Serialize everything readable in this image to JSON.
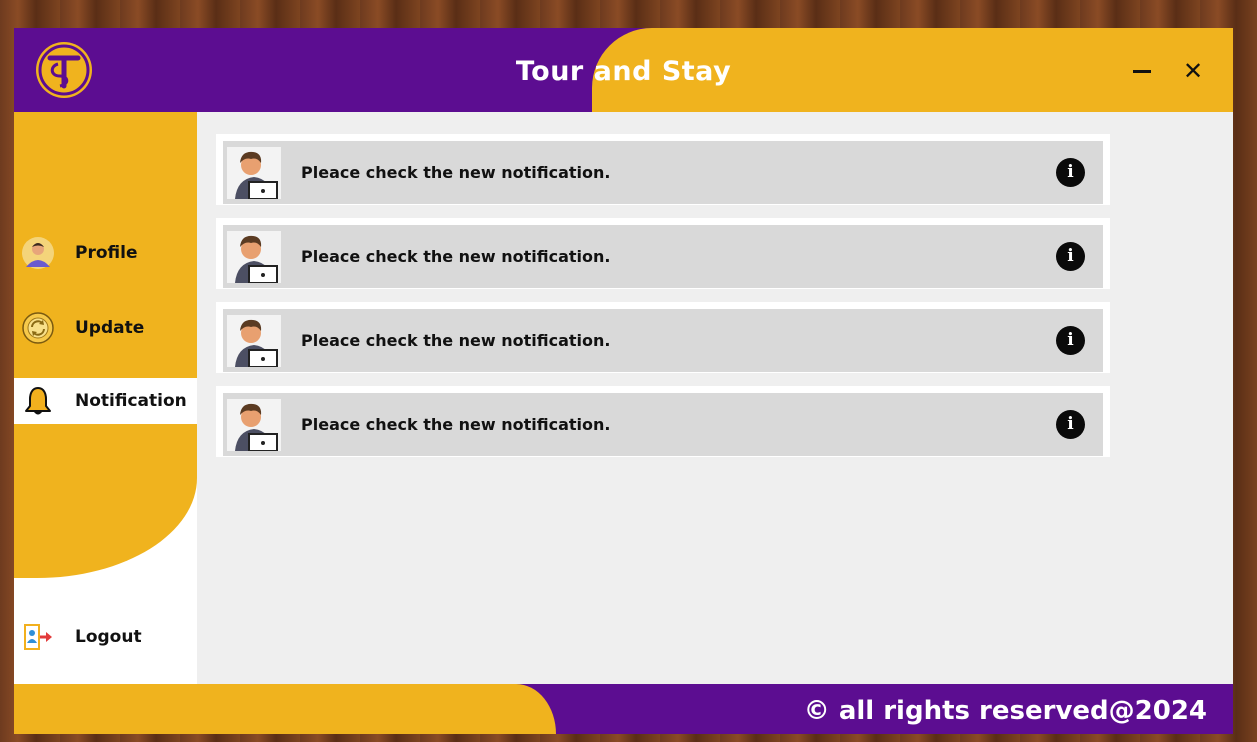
{
  "app": {
    "title_part1": "Tour an",
    "title_part2": "d Stay",
    "minimize_label": "–",
    "close_label": "✕"
  },
  "sidebar": {
    "items": [
      {
        "label": "Profile",
        "icon": "profile-avatar-icon"
      },
      {
        "label": "Update",
        "icon": "refresh-icon"
      },
      {
        "label": "Notification",
        "icon": "bell-icon",
        "active": true
      },
      {
        "label": "Logout",
        "icon": "logout-icon"
      }
    ]
  },
  "notifications": [
    {
      "text": "Pleace check the new notification.",
      "icon": "info-icon"
    },
    {
      "text": "Pleace check the new notification.",
      "icon": "info-icon"
    },
    {
      "text": "Pleace check the new notification.",
      "icon": "info-icon"
    },
    {
      "text": "Pleace check the new notification.",
      "icon": "info-icon"
    }
  ],
  "footer": {
    "text": "© all rights reserved@2024"
  },
  "colors": {
    "purple": "#5c0d91",
    "yellow": "#f0b31e",
    "main_bg": "#efefef",
    "card_bg": "#d9d9d9"
  }
}
